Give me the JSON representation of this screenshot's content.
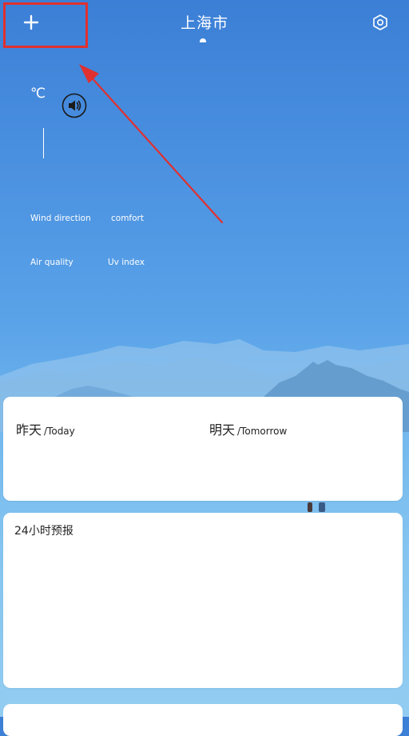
{
  "header": {
    "add_icon": "plus-icon",
    "city": "上海市",
    "settings_icon": "gear-icon",
    "annotation_box_color": "#e0302f"
  },
  "current": {
    "temp_unit": "℃",
    "sound_icon": "speaker-icon",
    "metrics": {
      "wind_label": "Wind direction",
      "comfort_label": "comfort",
      "air_label": "Air quality",
      "uv_label": "Uv index"
    }
  },
  "forecast_days": {
    "today_cn": "昨天",
    "today_en": "/Today",
    "tomorrow_cn": "明天",
    "tomorrow_en": "/Tomorrow"
  },
  "hourly": {
    "title": "24小时预报"
  },
  "colors": {
    "sky_top": "#3b7fd6",
    "sky_bottom": "#a8d8f5",
    "card": "#ffffff",
    "annotation": "#e0302f"
  }
}
